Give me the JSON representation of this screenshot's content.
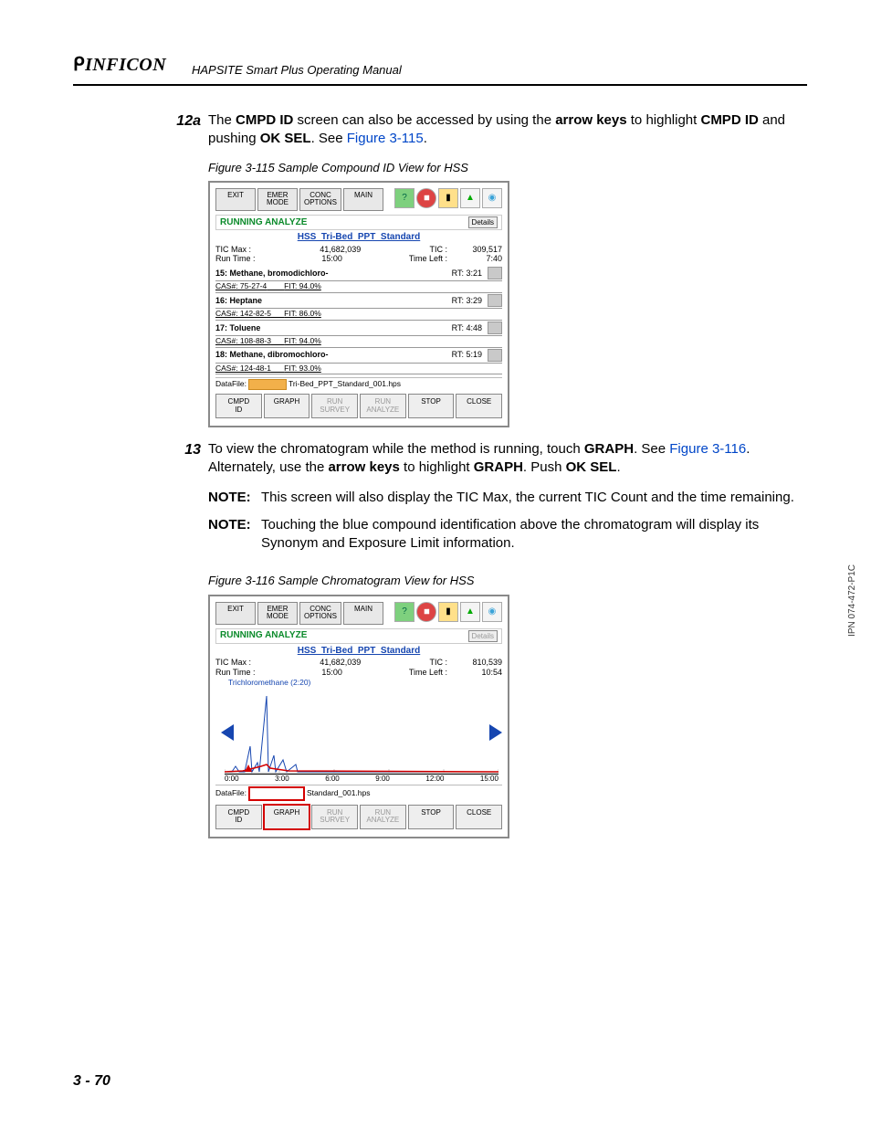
{
  "header": {
    "brand": "INFICON",
    "manual_title": "HAPSITE Smart Plus Operating Manual"
  },
  "page_number_label": "3 - 70",
  "side_code": "IPN 074-472-P1C",
  "steps": {
    "s12a": {
      "num": "12a",
      "pre": "The ",
      "b1": "CMPD ID",
      "mid1": " screen can also be accessed by using the ",
      "b2": "arrow keys",
      "mid2": " to highlight ",
      "b3": "CMPD ID",
      "mid3": " and pushing ",
      "b4": "OK SEL",
      "mid4": ". See ",
      "link": "Figure 3-115",
      "after": "."
    },
    "s13": {
      "num": "13",
      "pre": "To view the chromatogram while the method is running, touch ",
      "b1": "GRAPH",
      "mid1": ". See ",
      "link": "Figure 3-116",
      "mid2": ". Alternately, use the ",
      "b2": "arrow keys",
      "mid3": " to highlight ",
      "b3": "GRAPH",
      "mid4": ". Push ",
      "b4": "OK SEL",
      "after": "."
    }
  },
  "notes": {
    "n1": {
      "label": "NOTE:",
      "text": "This screen will also display the TIC Max, the current TIC Count and the time remaining."
    },
    "n2": {
      "label": "NOTE:",
      "text": "Touching the blue compound identification above the chromatogram will display its Synonym and Exposure Limit information."
    }
  },
  "figures": {
    "f115": {
      "caption": "Figure 3-115  Sample Compound ID View for HSS",
      "toolbar": [
        "EXIT",
        "EMER\nMODE",
        "CONC\nOPTIONS",
        "MAIN"
      ],
      "icons": [
        "help-icon",
        "info-icon",
        "battery-icon",
        "signal-icon",
        "status-icon"
      ],
      "status": "RUNNING ANALYZE",
      "details": "Details",
      "method": "HSS_Tri-Bed_PPT_Standard",
      "tic_max_label": "TIC Max :",
      "tic_max_val": "41,682,039",
      "tic_label": "TIC :",
      "tic_val": "309,517",
      "run_time_label": "Run Time :",
      "run_time_val": "15:00",
      "time_left_label": "Time Left :",
      "time_left_val": "7:40",
      "compounds": [
        {
          "name": "15: Methane, bromodichloro-",
          "rt": "RT: 3:21",
          "cas": "CAS#: 75-27-4",
          "fit": "FIT: 94.0%"
        },
        {
          "name": "16: Heptane",
          "rt": "RT: 3:29",
          "cas": "CAS#: 142-82-5",
          "fit": "FIT: 86.0%"
        },
        {
          "name": "17: Toluene",
          "rt": "RT: 4:48",
          "cas": "CAS#: 108-88-3",
          "fit": "FIT: 94.0%"
        },
        {
          "name": "18: Methane, dibromochloro-",
          "rt": "RT: 5:19",
          "cas": "CAS#: 124-48-1",
          "fit": "FIT: 93.0%"
        }
      ],
      "datafile_label": "DataFile:",
      "datafile": "Tri-Bed_PPT_Standard_001.hps",
      "bottom_buttons": [
        "CMPD\nID",
        "GRAPH",
        "RUN\nSURVEY",
        "RUN\nANALYZE",
        "STOP",
        "CLOSE"
      ]
    },
    "f116": {
      "caption": "Figure 3-116  Sample Chromatogram View for HSS",
      "toolbar": [
        "EXIT",
        "EMER\nMODE",
        "CONC\nOPTIONS",
        "MAIN"
      ],
      "icons": [
        "help-icon",
        "info-icon",
        "battery-icon",
        "signal-icon",
        "status-icon"
      ],
      "status": "RUNNING ANALYZE",
      "details": "Details",
      "method": "HSS_Tri-Bed_PPT_Standard",
      "tic_max_label": "TIC Max :",
      "tic_max_val": "41,682,039",
      "tic_label": "TIC :",
      "tic_val": "810,539",
      "run_time_label": "Run Time :",
      "run_time_val": "15:00",
      "time_left_label": "Time Left :",
      "time_left_val": "10:54",
      "annotation": "Trichloromethane (2:20)",
      "xaxis": [
        "0:00",
        "3:00",
        "6:00",
        "9:00",
        "12:00",
        "15:00"
      ],
      "datafile_label": "DataFile:",
      "datafile": "Standard_001.hps",
      "bottom_buttons": [
        "CMPD\nID",
        "GRAPH",
        "RUN\nSURVEY",
        "RUN\nANALYZE",
        "STOP",
        "CLOSE"
      ]
    }
  }
}
